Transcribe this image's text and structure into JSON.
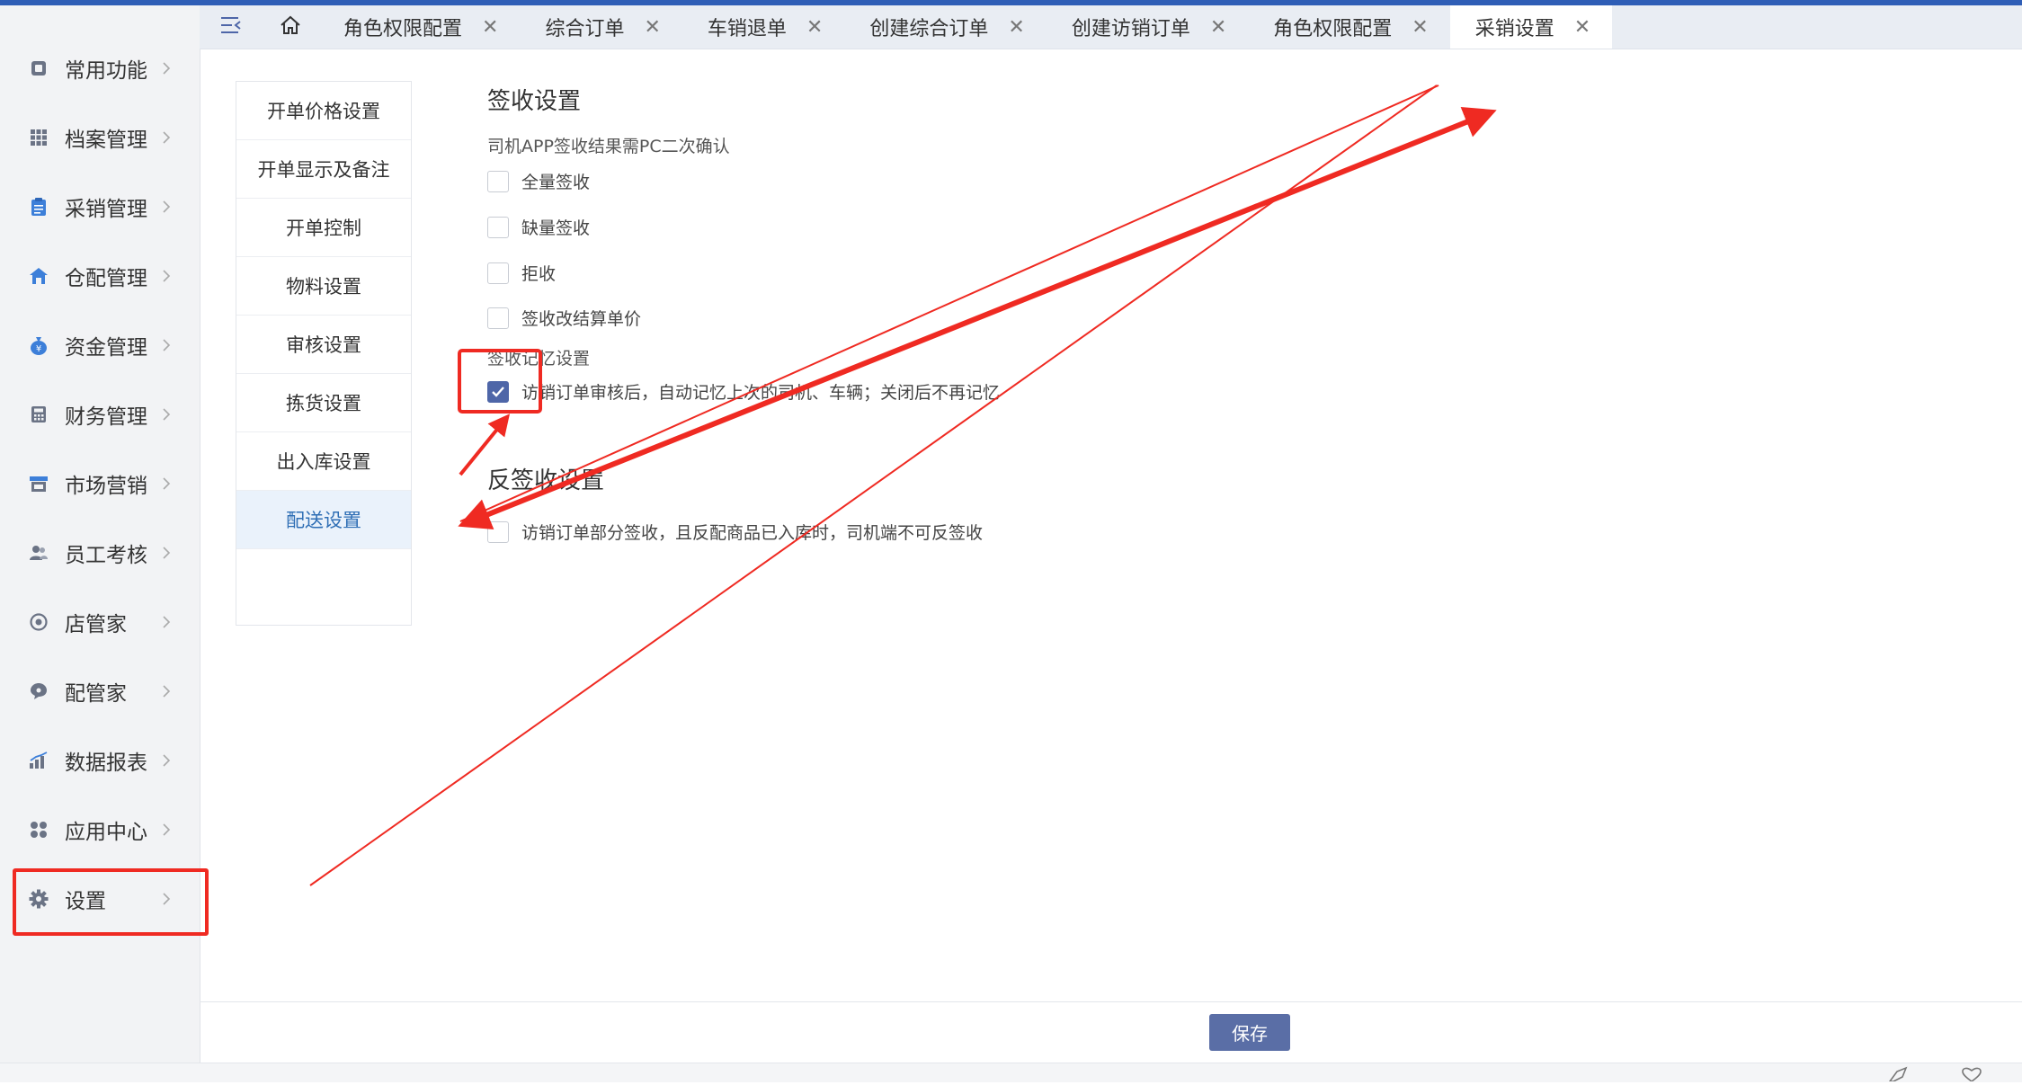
{
  "sidebar": {
    "items": [
      {
        "label": "常用功能",
        "icon": "common-icon"
      },
      {
        "label": "档案管理",
        "icon": "grid-icon"
      },
      {
        "label": "采销管理",
        "icon": "clipboard-icon"
      },
      {
        "label": "仓配管理",
        "icon": "warehouse-icon"
      },
      {
        "label": "资金管理",
        "icon": "money-bag-icon"
      },
      {
        "label": "财务管理",
        "icon": "calculator-icon"
      },
      {
        "label": "市场营销",
        "icon": "store-icon"
      },
      {
        "label": "员工考核",
        "icon": "users-icon"
      },
      {
        "label": "店管家",
        "icon": "shop-icon"
      },
      {
        "label": "配管家",
        "icon": "chat-icon"
      },
      {
        "label": "数据报表",
        "icon": "bar-chart-icon"
      },
      {
        "label": "应用中心",
        "icon": "apps-icon"
      },
      {
        "label": "设置",
        "icon": "gear-icon"
      }
    ]
  },
  "tabs": [
    {
      "label": "角色权限配置"
    },
    {
      "label": "综合订单"
    },
    {
      "label": "车销退单"
    },
    {
      "label": "创建综合订单"
    },
    {
      "label": "创建访销订单"
    },
    {
      "label": "角色权限配置"
    },
    {
      "label": "采销设置",
      "active": true
    }
  ],
  "tab_close": "✕",
  "subnav": {
    "items": [
      {
        "label": "开单价格设置"
      },
      {
        "label": "开单显示及备注"
      },
      {
        "label": "开单控制"
      },
      {
        "label": "物料设置"
      },
      {
        "label": "审核设置"
      },
      {
        "label": "拣货设置"
      },
      {
        "label": "出入库设置"
      },
      {
        "label": "配送设置",
        "active": true
      }
    ]
  },
  "sign_section": {
    "title": "签收设置",
    "confirm_label": "司机APP签收结果需PC二次确认",
    "options": [
      {
        "label": "全量签收",
        "checked": false
      },
      {
        "label": "缺量签收",
        "checked": false
      },
      {
        "label": "拒收",
        "checked": false
      },
      {
        "label": "签收改结算单价",
        "checked": false
      }
    ],
    "memory_label": "签收记忆设置",
    "memory_option": {
      "label": "访销订单审核后，自动记忆上次的司机、车辆；关闭后不再记忆",
      "checked": true
    }
  },
  "reverse_section": {
    "title": "反签收设置",
    "option": {
      "label": "访销订单部分签收，且反配商品已入库时，司机端不可反签收",
      "checked": false
    }
  },
  "save_label": "保存",
  "colors": {
    "annotation": "#ef2a22",
    "accent": "#2f5eb6",
    "checkbox": "#4e66a8"
  }
}
